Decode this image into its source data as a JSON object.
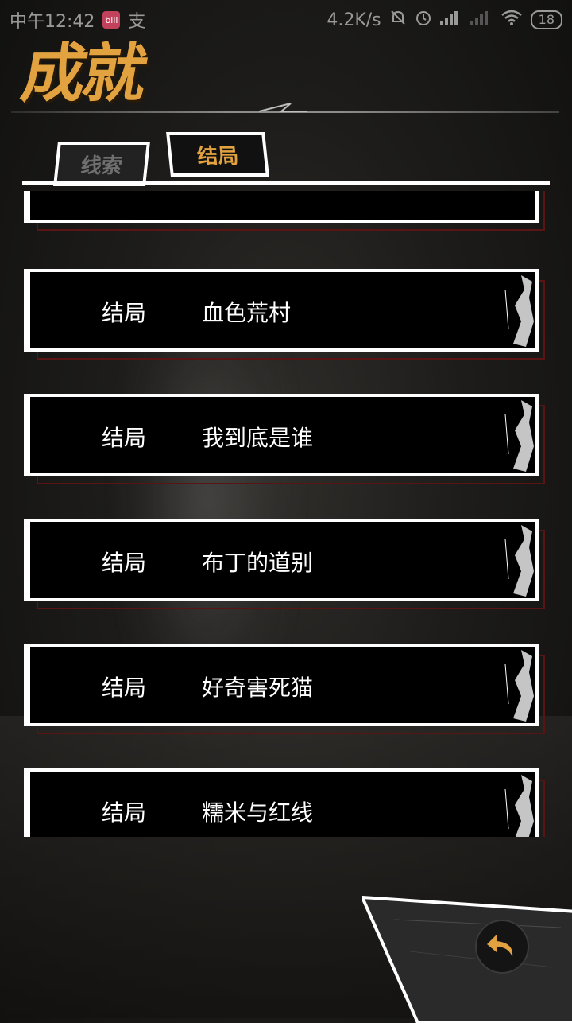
{
  "status_bar": {
    "time": "中午12:42",
    "badge": "bili",
    "extra_icon": "支",
    "network_speed": "4.2K/s",
    "battery": "18"
  },
  "header": {
    "title": "成就"
  },
  "tabs": [
    {
      "label": "线索",
      "active": false
    },
    {
      "label": "结局",
      "active": true
    }
  ],
  "list": {
    "items": [
      {
        "label": "结局",
        "name": "血色荒村"
      },
      {
        "label": "结局",
        "name": "我到底是谁"
      },
      {
        "label": "结局",
        "name": "布丁的道别"
      },
      {
        "label": "结局",
        "name": "好奇害死猫"
      },
      {
        "label": "结局",
        "name": "糯米与红线"
      }
    ]
  },
  "colors": {
    "accent": "#e1a23f",
    "inactive_tab": "#6f6f6f",
    "card_shadow": "#5b1414"
  },
  "icons": {
    "back": "back-arrow-icon",
    "mute": "mute-bell-icon",
    "alarm": "alarm-icon",
    "signal": "signal-icon",
    "wifi": "wifi-icon",
    "battery": "battery-icon"
  }
}
